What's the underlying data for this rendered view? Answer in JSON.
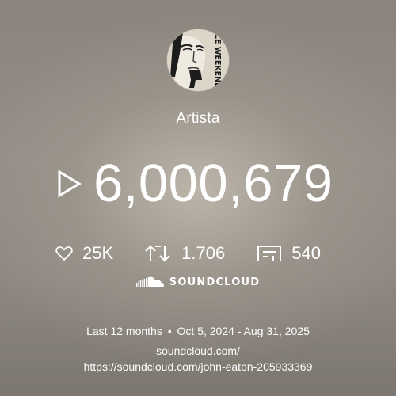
{
  "profile": {
    "avatar_text": "LE WEEKEND",
    "artist_label": "Artista"
  },
  "plays": {
    "icon": "play-icon",
    "count": "6,000,679"
  },
  "stats": {
    "likes": {
      "icon": "heart-icon",
      "value": "25K"
    },
    "reposts": {
      "icon": "repost-icon",
      "value": "1.706"
    },
    "comments": {
      "icon": "comment-icon",
      "value": "540"
    }
  },
  "brand": {
    "icon": "soundcloud-logo-icon",
    "name": "SOUNDCLOUD"
  },
  "period": {
    "label": "Last 12 months",
    "separator": "•",
    "range": "Oct 5, 2024 - Aug 31, 2025"
  },
  "links": {
    "line1": "soundcloud.com/",
    "line2": "https://soundcloud.com/john-eaton-205933369"
  },
  "colors": {
    "text": "#ffffff",
    "background": "#8e8881"
  }
}
